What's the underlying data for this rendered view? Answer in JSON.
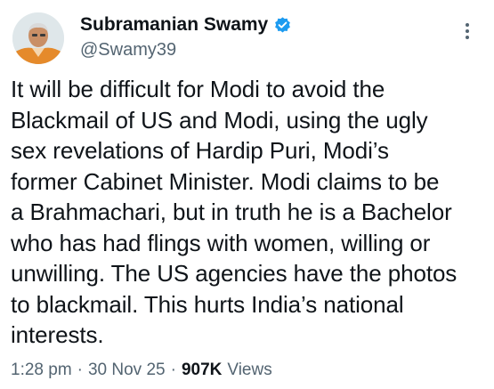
{
  "author": {
    "name": "Subramanian Swamy",
    "handle": "@Swamy39",
    "verified_color": "#1d9bf0"
  },
  "more_icon": "more-vertical-icon",
  "tweet": {
    "text": "It will be difficult for Modi to avoid the\nBlackmail of US and Modi, using the ugly\nsex revelations of Hardip Puri, Modi’s\nformer Cabinet Minister. Modi claims to be\na Brahmachari, but in truth he is a Bachelor\nwho has had flings with women, willing or\nunwilling. The US agencies have the photos\nto blackmail. This hurts India’s national\ninterests.",
    "time": "1:28 pm",
    "date": "30 Nov 25",
    "views_count": "907K",
    "views_label": "Views",
    "separator": "·"
  }
}
